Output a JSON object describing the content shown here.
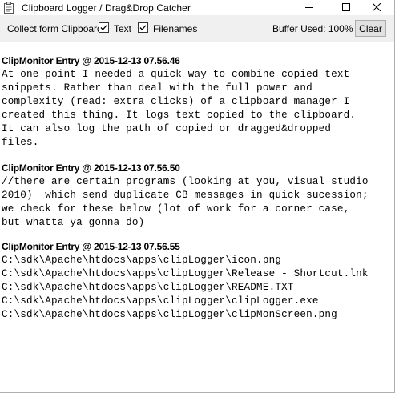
{
  "window": {
    "title": "Clipboard Logger / Drag&Drop Catcher",
    "icon": "clipboard-icon",
    "controls": [
      "minimize-icon",
      "maximize-icon",
      "close-icon"
    ]
  },
  "toolbar": {
    "collect_label": "Collect form Clipboard:",
    "text_checkbox": {
      "label": "Text",
      "checked": true
    },
    "filenames_checkbox": {
      "label": "Filenames",
      "checked": true
    },
    "buffer_label": "Buffer Used: 100%",
    "clear_label": "Clear"
  },
  "log": {
    "entries": [
      {
        "header": "ClipMonitor Entry @ 2015-12-13 07.56.46",
        "lines": [
          "At one point I needed a quick way to combine copied text",
          "snippets. Rather than deal with the full power and",
          "complexity (read: extra clicks) of a clipboard manager I",
          "created this thing. It logs text copied to the clipboard.",
          "It can also log the path of copied or dragged&dropped",
          "files."
        ]
      },
      {
        "header": "ClipMonitor Entry @ 2015-12-13 07.56.50",
        "lines": [
          "//there are certain programs (looking at you, visual studio",
          "2010)  which send duplicate CB messages in quick sucession;",
          "we check for these below (lot of work for a corner case,",
          "but whatta ya gonna do)"
        ]
      },
      {
        "header": "ClipMonitor Entry @ 2015-12-13 07.56.55",
        "lines": [
          "C:\\sdk\\Apache\\htdocs\\apps\\clipLogger\\icon.png",
          "C:\\sdk\\Apache\\htdocs\\apps\\clipLogger\\Release - Shortcut.lnk",
          "C:\\sdk\\Apache\\htdocs\\apps\\clipLogger\\README.TXT",
          "C:\\sdk\\Apache\\htdocs\\apps\\clipLogger\\clipLogger.exe",
          "C:\\sdk\\Apache\\htdocs\\apps\\clipLogger\\clipMonScreen.png"
        ]
      }
    ]
  }
}
